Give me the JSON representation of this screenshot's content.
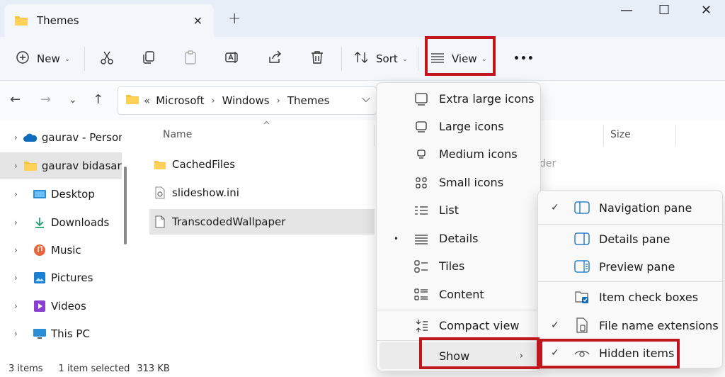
{
  "window": {
    "tab_title": "Themes",
    "new_tab_symbol": "+",
    "tab_close_symbol": "✕",
    "minimize_symbol": "—",
    "maximize_symbol": "☐",
    "close_symbol": "✕"
  },
  "toolbar": {
    "new_label": "New",
    "sort_label": "Sort",
    "view_label": "View",
    "more_symbol": "•••",
    "highlight_color": "#c0161d"
  },
  "address": {
    "overflow": "«",
    "crumbs": [
      "Microsoft",
      "Windows",
      "Themes"
    ],
    "separator": "›",
    "dropdown_symbol": "⌵"
  },
  "sidebar": {
    "items": [
      {
        "label": "gaurav - Personal",
        "icon": "onedrive-icon",
        "selected": false
      },
      {
        "label": "gaurav bidasaria",
        "icon": "folder-icon",
        "selected": true
      },
      {
        "label": "Desktop",
        "icon": "desktop-icon",
        "selected": false
      },
      {
        "label": "Downloads",
        "icon": "download-icon",
        "selected": false
      },
      {
        "label": "Music",
        "icon": "music-icon",
        "selected": false
      },
      {
        "label": "Pictures",
        "icon": "pictures-icon",
        "selected": false
      },
      {
        "label": "Videos",
        "icon": "videos-icon",
        "selected": false
      },
      {
        "label": "This PC",
        "icon": "pc-icon",
        "selected": false
      }
    ]
  },
  "filelist": {
    "columns": {
      "name": "Name",
      "size": "Size"
    },
    "sort_indicator": "^",
    "files": [
      {
        "name": "CachedFiles",
        "icon": "folder-icon",
        "selected": false
      },
      {
        "name": "slideshow.ini",
        "icon": "settings-file-icon",
        "selected": false
      },
      {
        "name": "TranscodedWallpaper",
        "icon": "file-icon",
        "selected": true
      }
    ],
    "partial_type_text": "der"
  },
  "view_menu": {
    "items": [
      {
        "label": "Extra large icons",
        "icon": "monitor-large-icon"
      },
      {
        "label": "Large icons",
        "icon": "monitor-icon"
      },
      {
        "label": "Medium icons",
        "icon": "monitor-small-icon"
      },
      {
        "label": "Small icons",
        "icon": "small-icons-icon"
      },
      {
        "label": "List",
        "icon": "list-icon"
      },
      {
        "label": "Details",
        "icon": "details-icon",
        "bullet": "•"
      },
      {
        "label": "Tiles",
        "icon": "tiles-icon"
      },
      {
        "label": "Content",
        "icon": "content-icon"
      }
    ],
    "compact_label": "Compact view",
    "show_label": "Show",
    "submenu_arrow": "›"
  },
  "show_menu": {
    "items": [
      {
        "label": "Navigation pane",
        "icon": "navigation-pane-icon",
        "check": "✓"
      },
      {
        "label": "Details pane",
        "icon": "details-pane-icon",
        "check": ""
      },
      {
        "label": "Preview pane",
        "icon": "preview-pane-icon",
        "check": ""
      },
      {
        "label": "Item check boxes",
        "icon": "check-boxes-icon",
        "check": ""
      },
      {
        "label": "File name extensions",
        "icon": "file-extensions-icon",
        "check": "✓"
      },
      {
        "label": "Hidden items",
        "icon": "hidden-items-icon",
        "check": "✓"
      }
    ]
  },
  "status": {
    "items_count": "3 items",
    "selected": "1 item selected",
    "size": "313 KB"
  }
}
